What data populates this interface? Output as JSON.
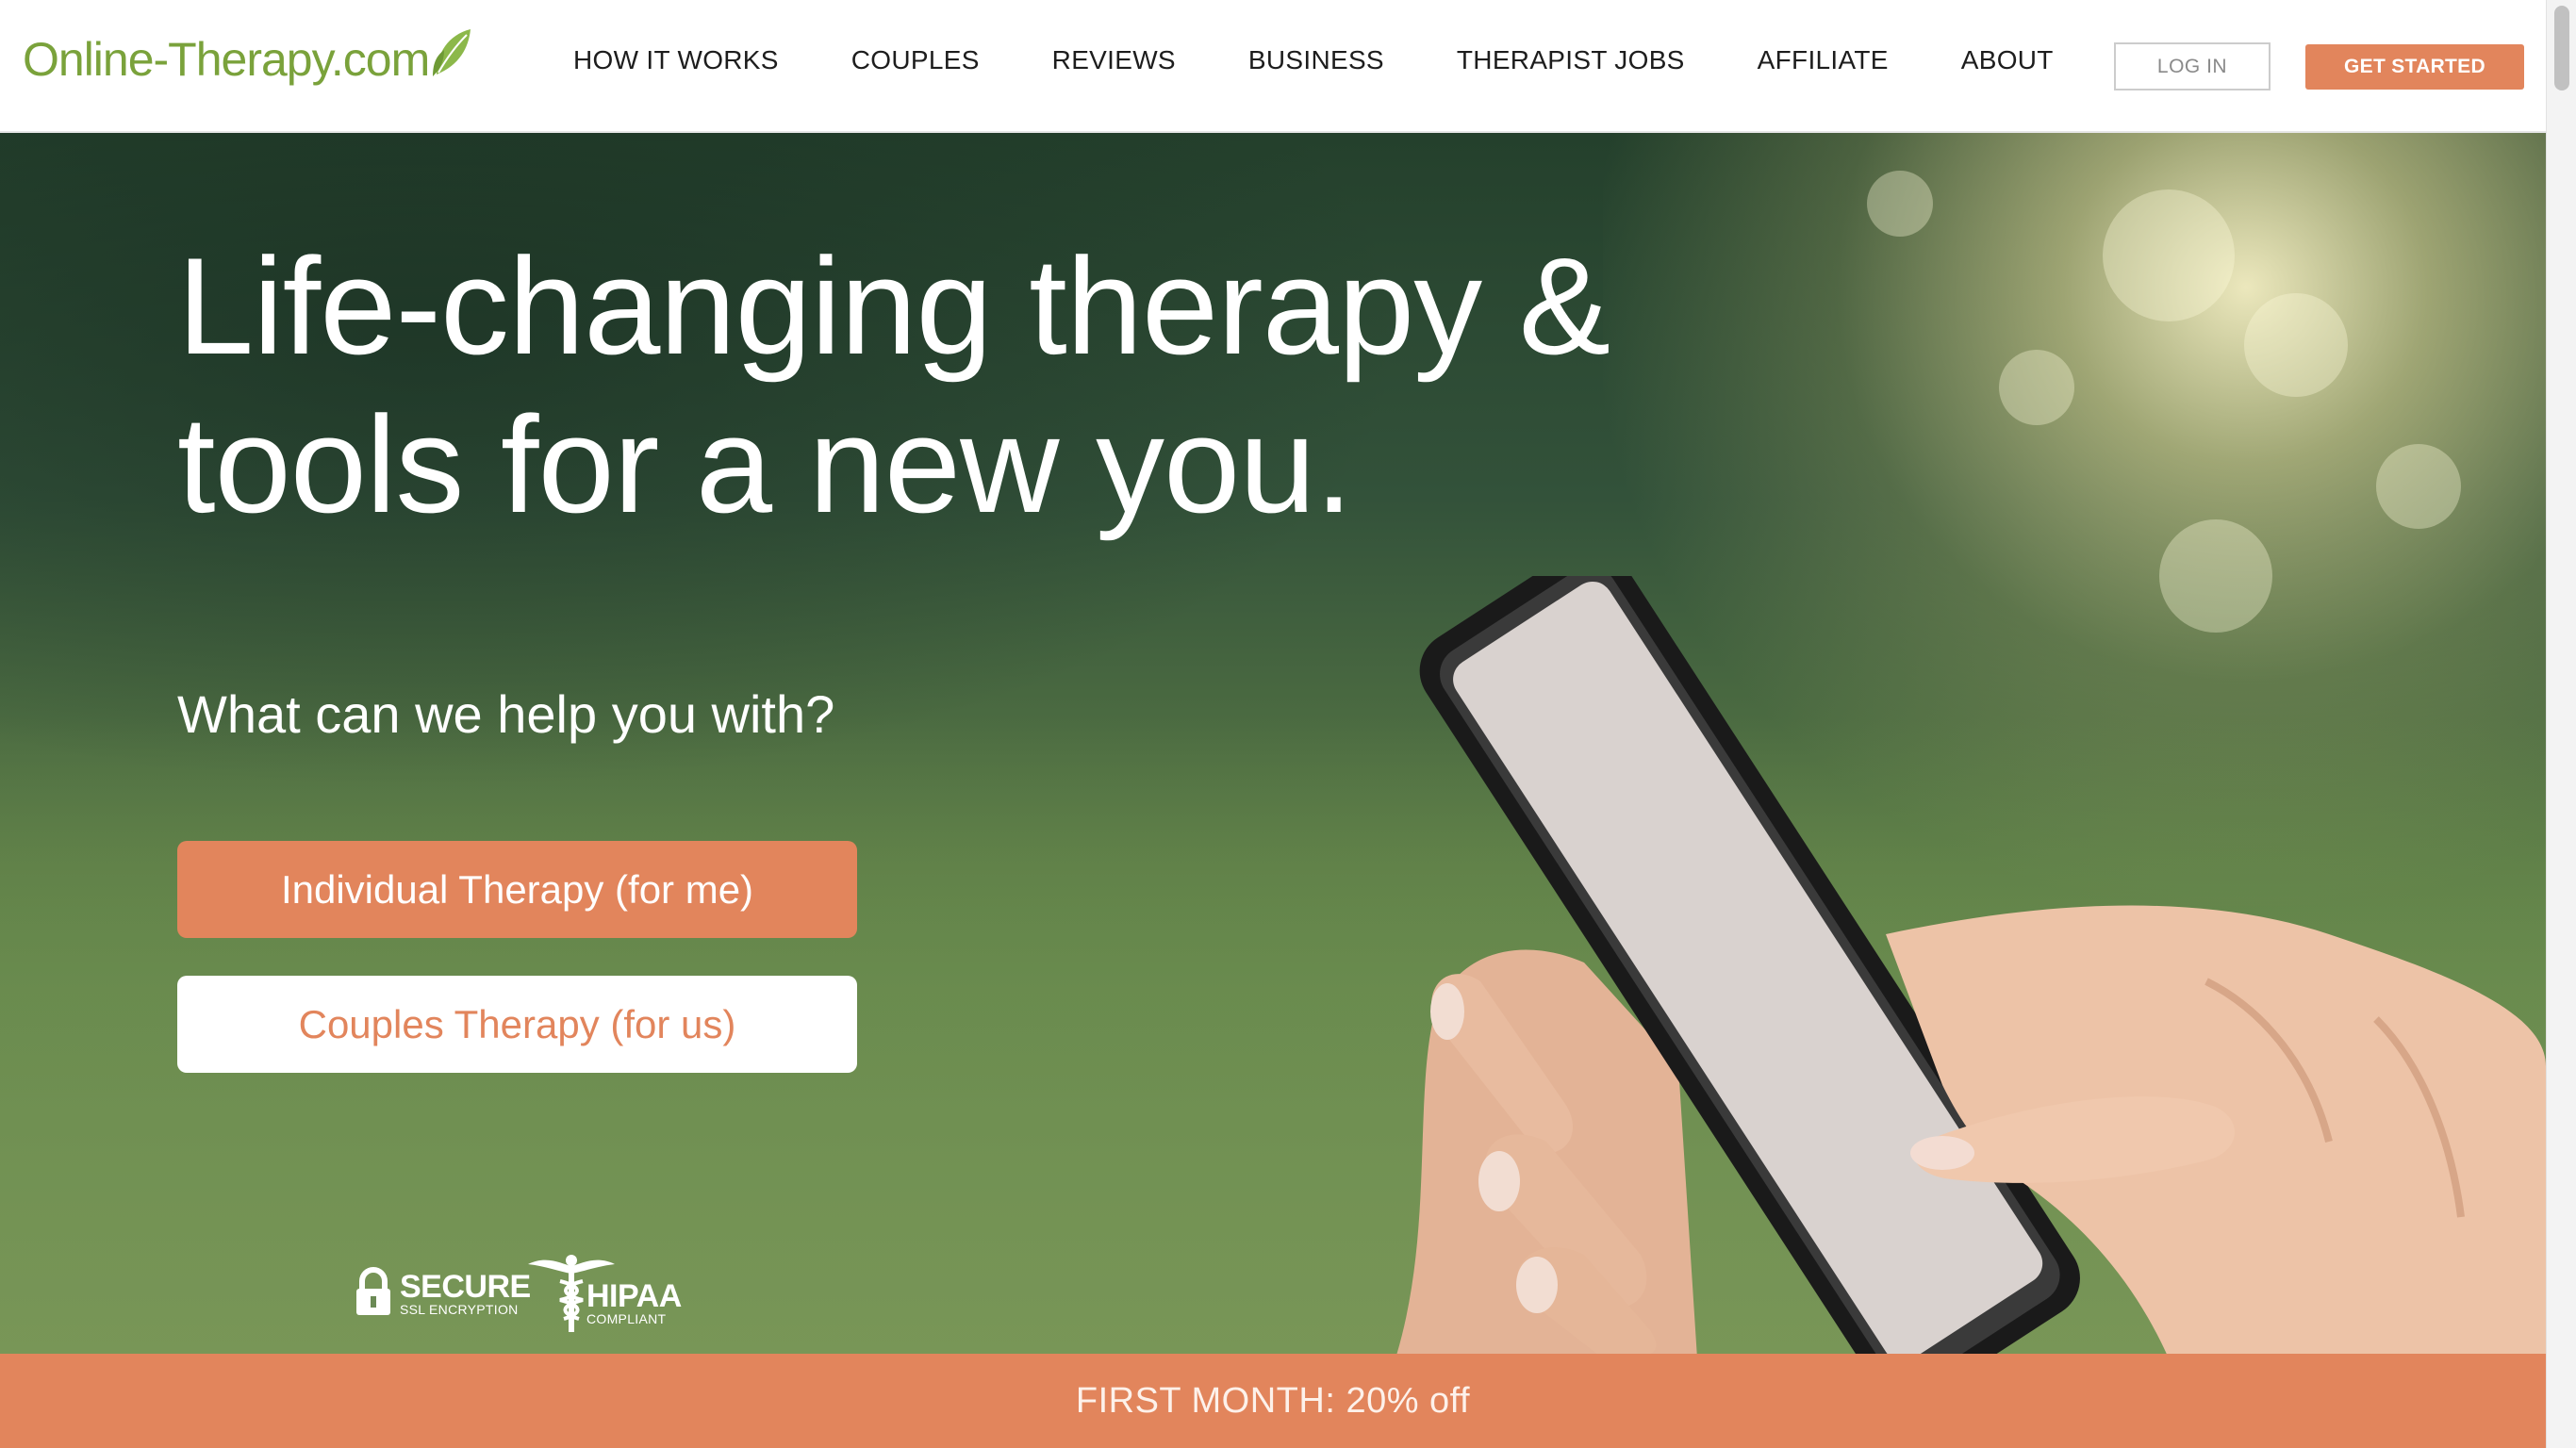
{
  "header": {
    "logo_text": "Online-Therapy.com",
    "nav": [
      {
        "label": "HOW IT WORKS"
      },
      {
        "label": "COUPLES"
      },
      {
        "label": "REVIEWS"
      },
      {
        "label": "BUSINESS"
      },
      {
        "label": "THERAPIST JOBS"
      },
      {
        "label": "AFFILIATE"
      },
      {
        "label": "ABOUT"
      }
    ],
    "login_label": "LOG IN",
    "get_started_label": "GET STARTED"
  },
  "hero": {
    "title_line1": "Life-changing therapy &",
    "title_line2": "tools for a new you.",
    "subtitle": "What can we help you with?",
    "individual_button": "Individual Therapy (for me)",
    "couples_button": "Couples Therapy (for us)"
  },
  "badges": {
    "secure_title": "SECURE",
    "secure_sub": "SSL ENCRYPTION",
    "hipaa_title": "HIPAA",
    "hipaa_sub": "COMPLIANT"
  },
  "promo": {
    "text": "FIRST MONTH: 20% off"
  },
  "colors": {
    "accent": "#e2855c",
    "logo_green": "#7aa23b"
  },
  "icons": [
    "leaf-icon",
    "lock-icon",
    "caduceus-icon"
  ]
}
